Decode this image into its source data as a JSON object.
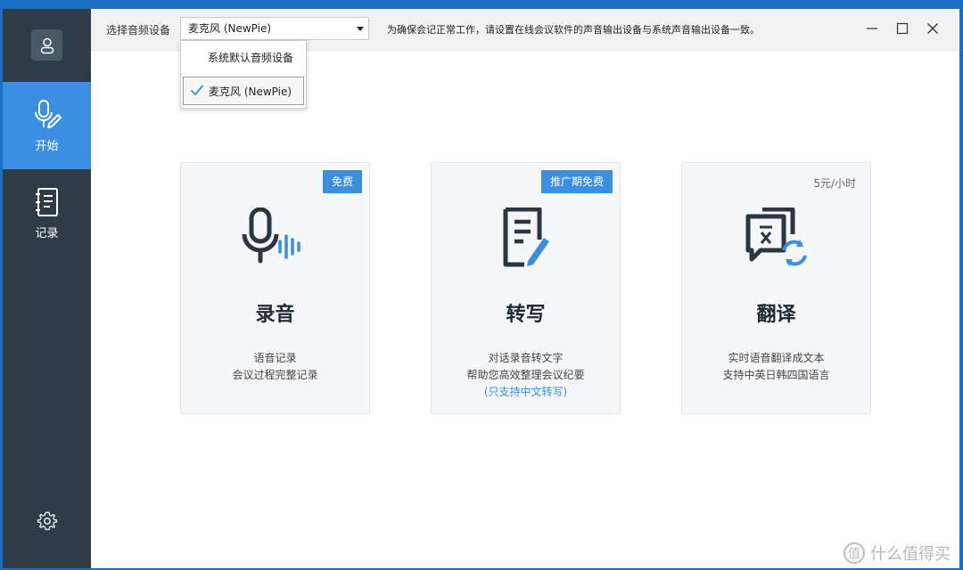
{
  "sidebar": {
    "items": [
      {
        "label": "开始",
        "icon": "mic-pen-icon",
        "active": true
      },
      {
        "label": "记录",
        "icon": "notebook-icon",
        "active": false
      }
    ]
  },
  "topbar": {
    "device_label": "选择音频设备",
    "device_selected": "麦克风 (NewPie)",
    "notice": "为确保会记正常工作，请设置在线会议软件的声音输出设备与系统声音输出设备一致。"
  },
  "dropdown": {
    "options": [
      {
        "label": "系统默认音频设备",
        "selected": false
      },
      {
        "label": "麦克风 (NewPie)",
        "selected": true
      }
    ]
  },
  "cards": [
    {
      "title": "录音",
      "badge": "免费",
      "desc_lines": [
        "语音记录",
        "会议过程完整记录"
      ],
      "icon": "microphone-wave-icon"
    },
    {
      "title": "转写",
      "badge": "推广期免费",
      "desc_lines": [
        "对话录音转文字",
        "帮助您高效整理会议纪要"
      ],
      "note": "(只支持中文转写)",
      "icon": "document-pen-icon"
    },
    {
      "title": "翻译",
      "price": "5元/小时",
      "desc_lines": [
        "实时语音翻译成文本",
        "支持中英日韩四国语言"
      ],
      "icon": "translate-refresh-icon"
    }
  ],
  "watermark": {
    "text": "什么值得买",
    "glyph": "值"
  },
  "colors": {
    "accent": "#3b8fe0",
    "sidebar": "#2e3c48",
    "desktop": "#1a6fc4"
  }
}
